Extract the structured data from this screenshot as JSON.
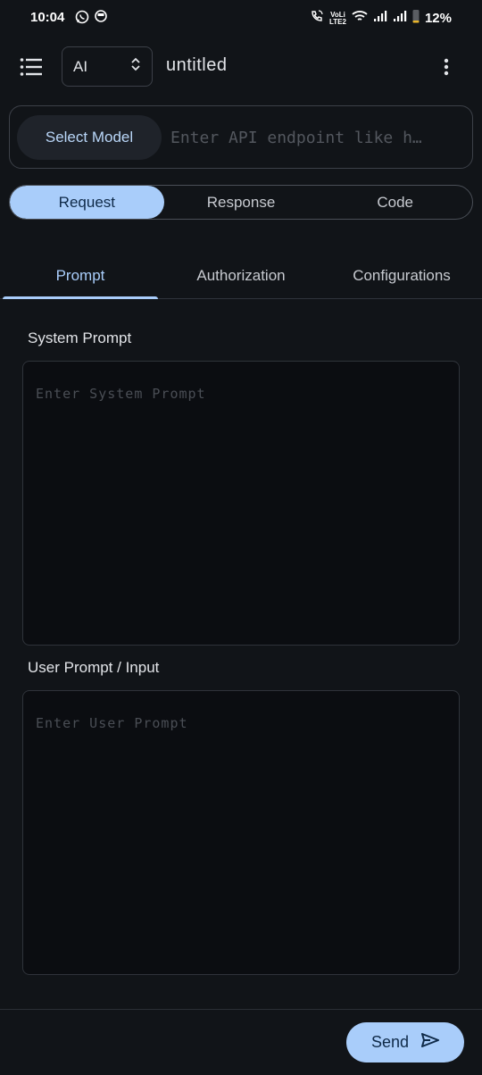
{
  "status_bar": {
    "time": "10:04",
    "left_icons": [
      "whatsapp-icon",
      "status-circle-icon"
    ],
    "right_icons": [
      "wifi-call-icon",
      "volte-icon",
      "wifi-icon",
      "signal-icon",
      "signal-icon",
      "battery-icon"
    ],
    "volte_line1": "VoLi",
    "volte_line2": "LTE2",
    "battery_percent": "12%"
  },
  "app_bar": {
    "menu_icon": "menu-list-icon",
    "method_value": "AI",
    "title": "untitled",
    "more_icon": "more-vert-icon"
  },
  "endpoint": {
    "select_model_label": "Select Model",
    "placeholder": "Enter API endpoint like h…"
  },
  "segments": [
    {
      "label": "Request",
      "active": true
    },
    {
      "label": "Response",
      "active": false
    },
    {
      "label": "Code",
      "active": false
    }
  ],
  "tabs": [
    {
      "label": "Prompt",
      "active": true
    },
    {
      "label": "Authorization",
      "active": false
    },
    {
      "label": "Configurations",
      "active": false
    }
  ],
  "system_prompt": {
    "label": "System Prompt",
    "placeholder": "Enter System Prompt"
  },
  "user_prompt": {
    "label": "User Prompt / Input",
    "placeholder": "Enter User Prompt"
  },
  "send": {
    "label": "Send",
    "icon": "send-icon"
  },
  "colors": {
    "background": "#111418",
    "accent": "#a9cdfa",
    "accent_text": "#0f2a48"
  }
}
